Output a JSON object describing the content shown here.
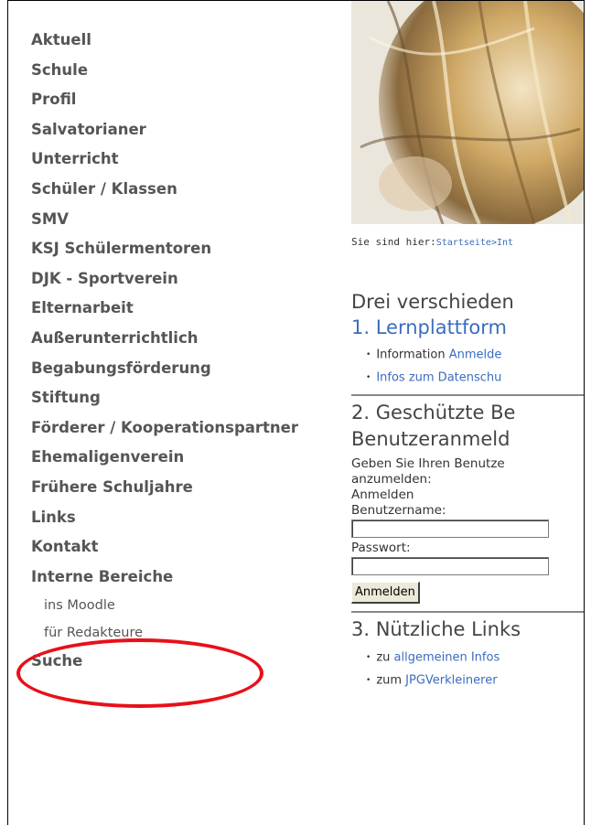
{
  "sidebar": {
    "items": [
      {
        "label": "Aktuell"
      },
      {
        "label": "Schule"
      },
      {
        "label": "Profil"
      },
      {
        "label": "Salvatorianer"
      },
      {
        "label": "Unterricht"
      },
      {
        "label": "Schüler / Klassen"
      },
      {
        "label": "SMV"
      },
      {
        "label": "KSJ Schülermentoren"
      },
      {
        "label": "DJK - Sportverein"
      },
      {
        "label": "Elternarbeit"
      },
      {
        "label": "Außerunterrichtlich"
      },
      {
        "label": "Begabungsförderung"
      },
      {
        "label": "Stiftung"
      },
      {
        "label": "Förderer / Kooperationspartner"
      },
      {
        "label": "Ehemaligenverein"
      },
      {
        "label": "Frühere Schuljahre"
      },
      {
        "label": "Links"
      },
      {
        "label": "Kontakt"
      },
      {
        "label": "Interne Bereiche"
      }
    ],
    "sub_items": [
      {
        "label": "ins Moodle"
      },
      {
        "label": "für Redakteure"
      }
    ],
    "last_item": {
      "label": "Suche"
    }
  },
  "breadcrumb": {
    "prefix": "Sie sind hier:",
    "link1": "Startseite",
    "separator": ">",
    "link2": "Int"
  },
  "content": {
    "title": "Drei verschieden",
    "section1": {
      "heading": "1. Lernplattform",
      "items": [
        {
          "text": "Information ",
          "link": "Anmelde"
        },
        {
          "text": "",
          "link": "Infos zum Datenschu"
        }
      ]
    },
    "section2": {
      "heading": "2. Geschützte Be",
      "subheading": "Benutzeranmeld",
      "intro_line1": "Geben Sie Ihren Benutze",
      "intro_line2": "anzumelden:",
      "login_title": "Anmelden",
      "username_label": "Benutzername:",
      "username_value": "",
      "password_label": "Passwort:",
      "password_value": "",
      "submit_label": "Anmelden"
    },
    "section3": {
      "heading": "3. Nützliche Links",
      "items": [
        {
          "text": "zu ",
          "link": "allgemeinen Infos"
        },
        {
          "text": "zum ",
          "link": "JPGVerkleinerer"
        }
      ]
    }
  },
  "colors": {
    "nav_text": "#555555",
    "link": "#3b6cc0",
    "highlight": "#e8101a"
  }
}
